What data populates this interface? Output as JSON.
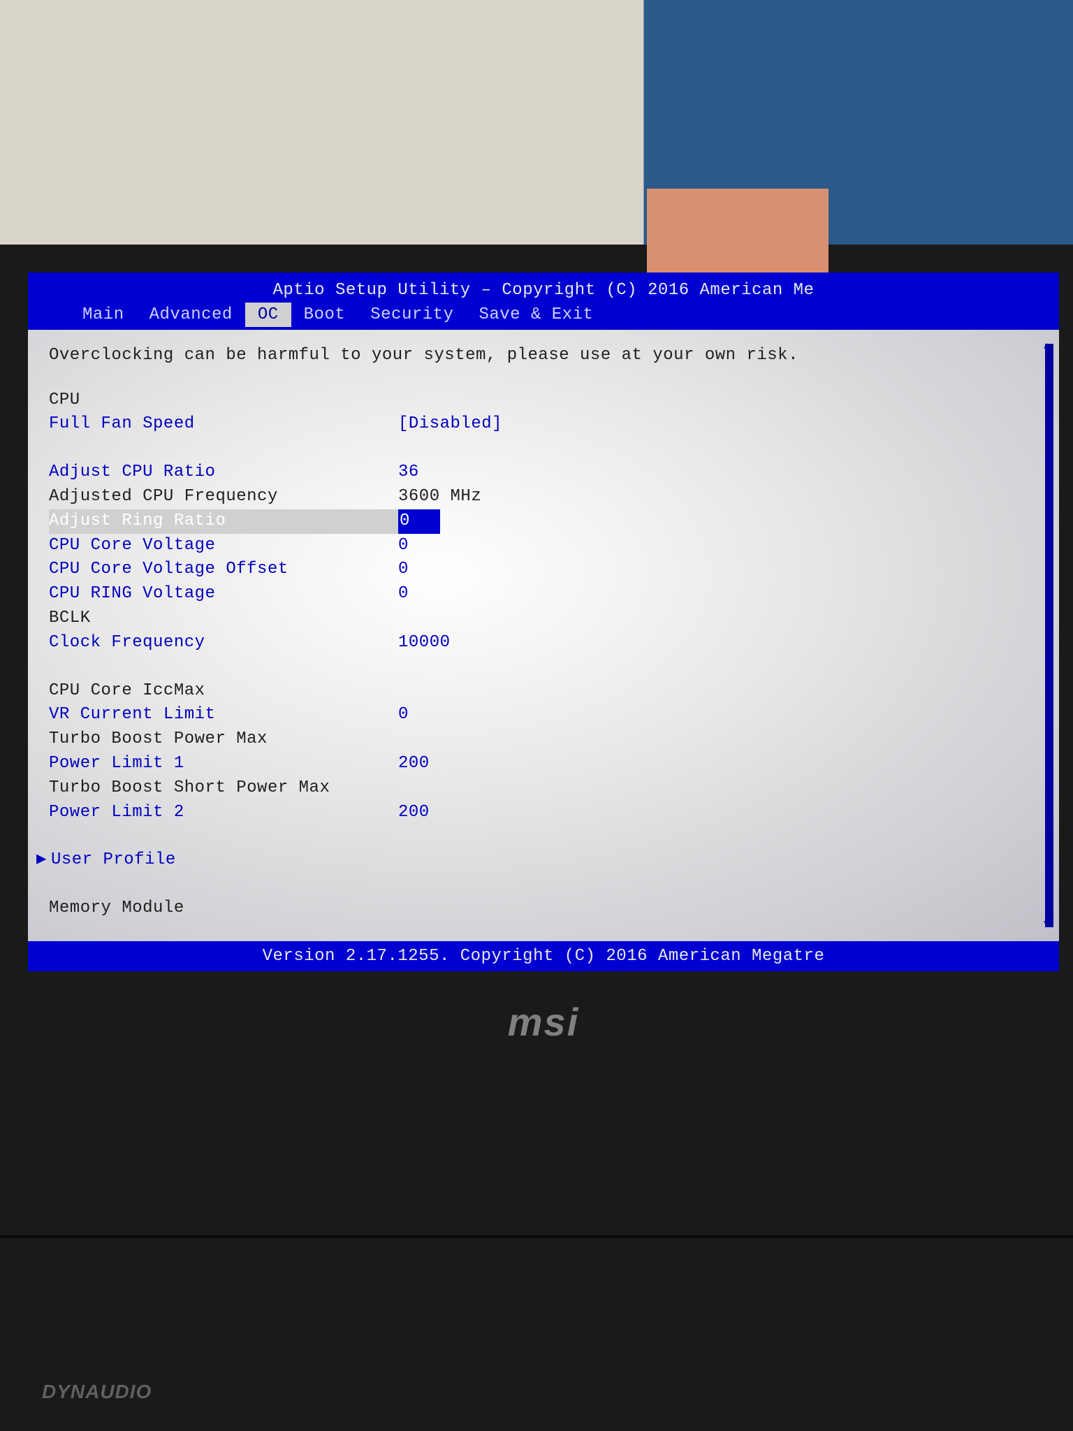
{
  "header": {
    "title": "Aptio Setup Utility – Copyright (C) 2016 American Me"
  },
  "tabs": [
    {
      "label": "Main",
      "active": false
    },
    {
      "label": "Advanced",
      "active": false
    },
    {
      "label": "OC",
      "active": true
    },
    {
      "label": "Boot",
      "active": false
    },
    {
      "label": "Security",
      "active": false
    },
    {
      "label": "Save & Exit",
      "active": false
    }
  ],
  "warning": "Overclocking can be harmful to your system, please use at your own risk.",
  "sections": {
    "cpu_header": "CPU",
    "full_fan_speed": {
      "label": "Full Fan Speed",
      "value": "[Disabled]"
    },
    "adjust_cpu_ratio": {
      "label": "Adjust CPU Ratio",
      "value": "36"
    },
    "adjusted_cpu_freq": {
      "label": "Adjusted CPU Frequency",
      "value": "3600 MHz"
    },
    "adjust_ring_ratio": {
      "label": "Adjust Ring Ratio",
      "value": "0"
    },
    "cpu_core_voltage": {
      "label": "CPU Core Voltage",
      "value": "0"
    },
    "cpu_core_voltage_offset": {
      "label": "CPU Core Voltage Offset",
      "value": "0"
    },
    "cpu_ring_voltage": {
      "label": "CPU RING Voltage",
      "value": "0"
    },
    "bclk_header": "BCLK",
    "clock_frequency": {
      "label": "Clock Frequency",
      "value": "10000"
    },
    "iccmax_header": "CPU Core IccMax",
    "vr_current_limit": {
      "label": "VR Current Limit",
      "value": "0"
    },
    "turbo_power_max_header": "Turbo Boost Power Max",
    "power_limit_1": {
      "label": "Power Limit 1",
      "value": "200"
    },
    "turbo_short_power_header": "Turbo Boost Short Power Max",
    "power_limit_2": {
      "label": "Power Limit 2",
      "value": "200"
    },
    "user_profile": "User Profile",
    "memory_module": "Memory Module"
  },
  "footer": "Version 2.17.1255. Copyright (C) 2016 American Megatre",
  "brand": "msi",
  "audio_brand": "DYNAUDIO"
}
